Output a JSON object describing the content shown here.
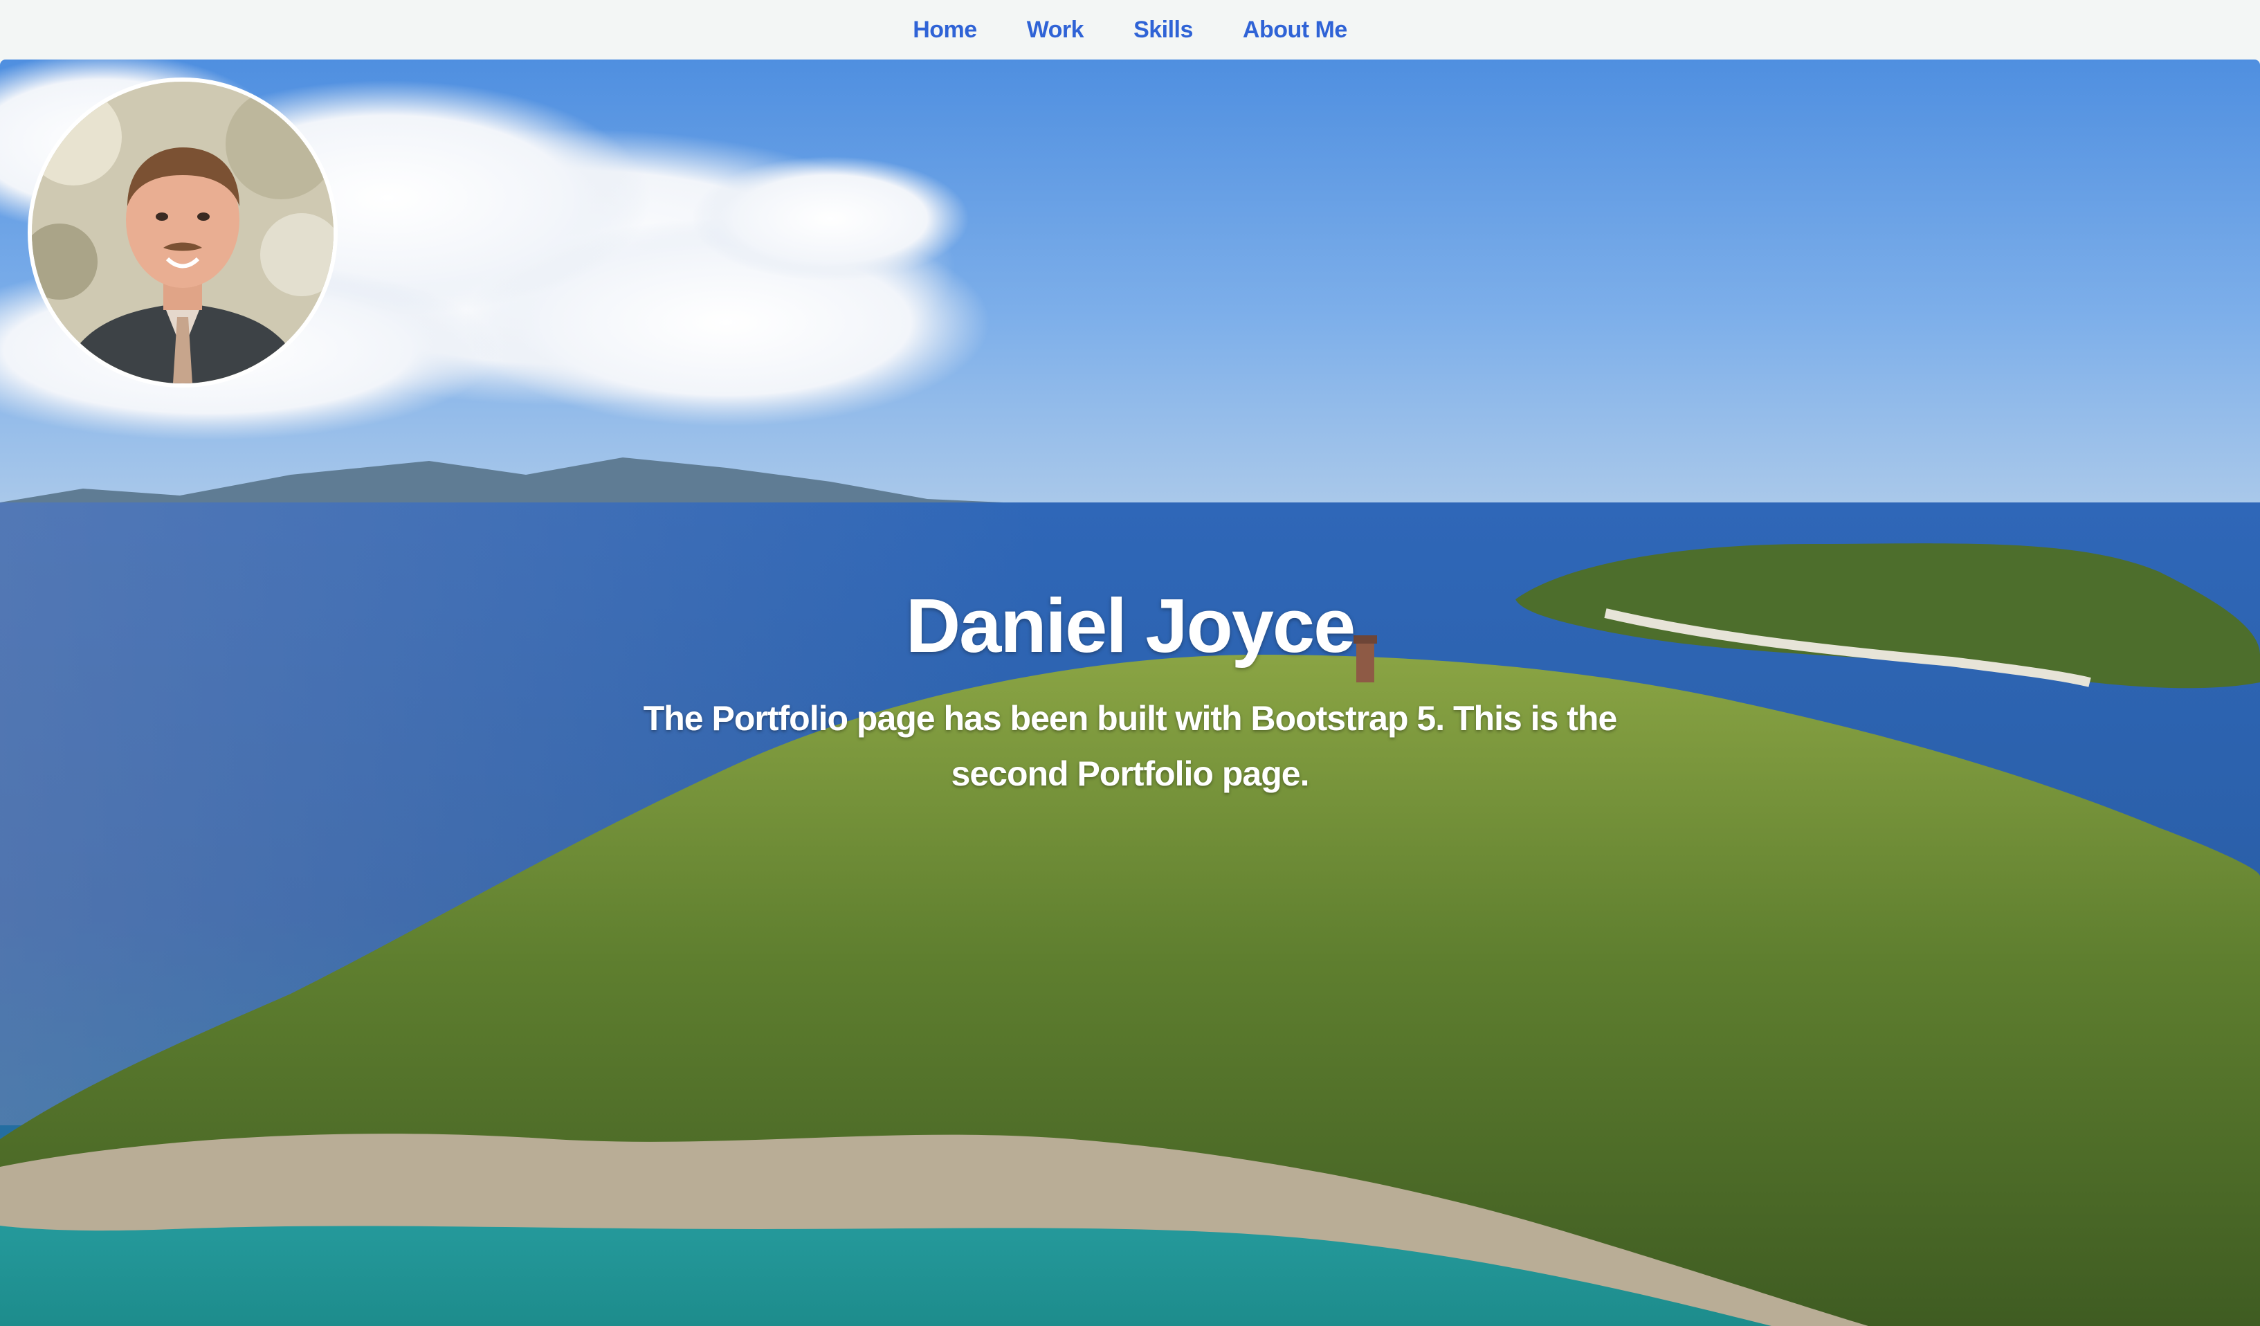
{
  "nav": {
    "items": [
      {
        "label": "Home"
      },
      {
        "label": "Work"
      },
      {
        "label": "Skills"
      },
      {
        "label": "About Me"
      }
    ]
  },
  "hero": {
    "title": "Daniel Joyce",
    "subtitle": "The Portfolio page has been built with Bootstrap 5. This is the second Portfolio page.",
    "background_image": "island-aerial-photo",
    "avatar_image": "profile-photo"
  },
  "colors": {
    "nav_background": "#f3f6f5",
    "nav_link": "#2f63d6",
    "hero_text": "#ffffff"
  }
}
